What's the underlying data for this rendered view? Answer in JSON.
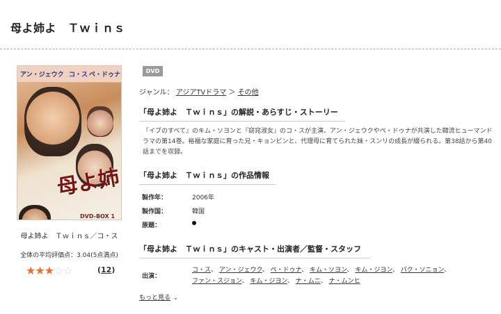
{
  "header": {
    "title": "母よ姉よ　Ｔｗｉｎｓ"
  },
  "cover": {
    "cast_names": [
      "アン・ジェウク",
      "コ・ス",
      "ペ・ドゥナ"
    ],
    "logo_text": "母よ姉よ",
    "box_label": "DVD-BOX 1"
  },
  "product": {
    "caption": "母よ姉よ　Ｔｗｉｎｓ／コ・ス",
    "average_rating_text": "全体の平均評価点：3.04(5点満点)",
    "rating": 3,
    "rating_max": 5,
    "review_count_open": "(",
    "review_count": "12",
    "review_count_close": ")"
  },
  "badge": "DVD",
  "genre": {
    "label": "ジャンル：",
    "items": [
      "アジアTVドラマ",
      "その他"
    ],
    "separator": "＞"
  },
  "sections": {
    "synopsis_heading": "「母よ姉よ　Ｔｗｉｎｓ」の解説・あらすじ・ストーリー",
    "synopsis_text": "『イブのすべて』のキム・ソヨンと『窈窕淑女』のコ・スが主演、アン・ジェウクやペ・ドゥナが共演した韓流ヒューマンドラマの第14巻。裕福な家庭に育った兄・キョンビンと、代理母に育てられた妹・スンリの成長が綴られる。第38話から第40話までを収録。",
    "info_heading": "「母よ姉よ　Ｔｗｉｎｓ」の作品情報",
    "info": [
      {
        "label": "製作年：",
        "value": "2006年"
      },
      {
        "label": "製作国：",
        "value": "韓国"
      },
      {
        "label": "原題：",
        "value": ""
      }
    ],
    "cast_heading": "「母よ姉よ　Ｔｗｉｎｓ」のキャスト・出演者／監督・スタッフ",
    "cast_label": "出演：",
    "cast": [
      "コ・ス",
      "アン・ジェウク",
      "ペ・ドゥナ",
      "キム・ソヨン",
      "キム・ジヨン",
      "パク・ソニョン",
      "ファン・スジョン",
      "キム・ジヨン",
      "ナ・ムニ",
      "ナ・ムンヒ"
    ],
    "more_label": "もっと見る"
  },
  "colors": {
    "star_on": "#e96f2e",
    "star_off": "#d9d9d9",
    "badge_bg": "#9a9a9a"
  },
  "icons": {
    "star": "star-icon",
    "more": "chevron-down-icon",
    "no_title": "bullet-dot-icon"
  }
}
